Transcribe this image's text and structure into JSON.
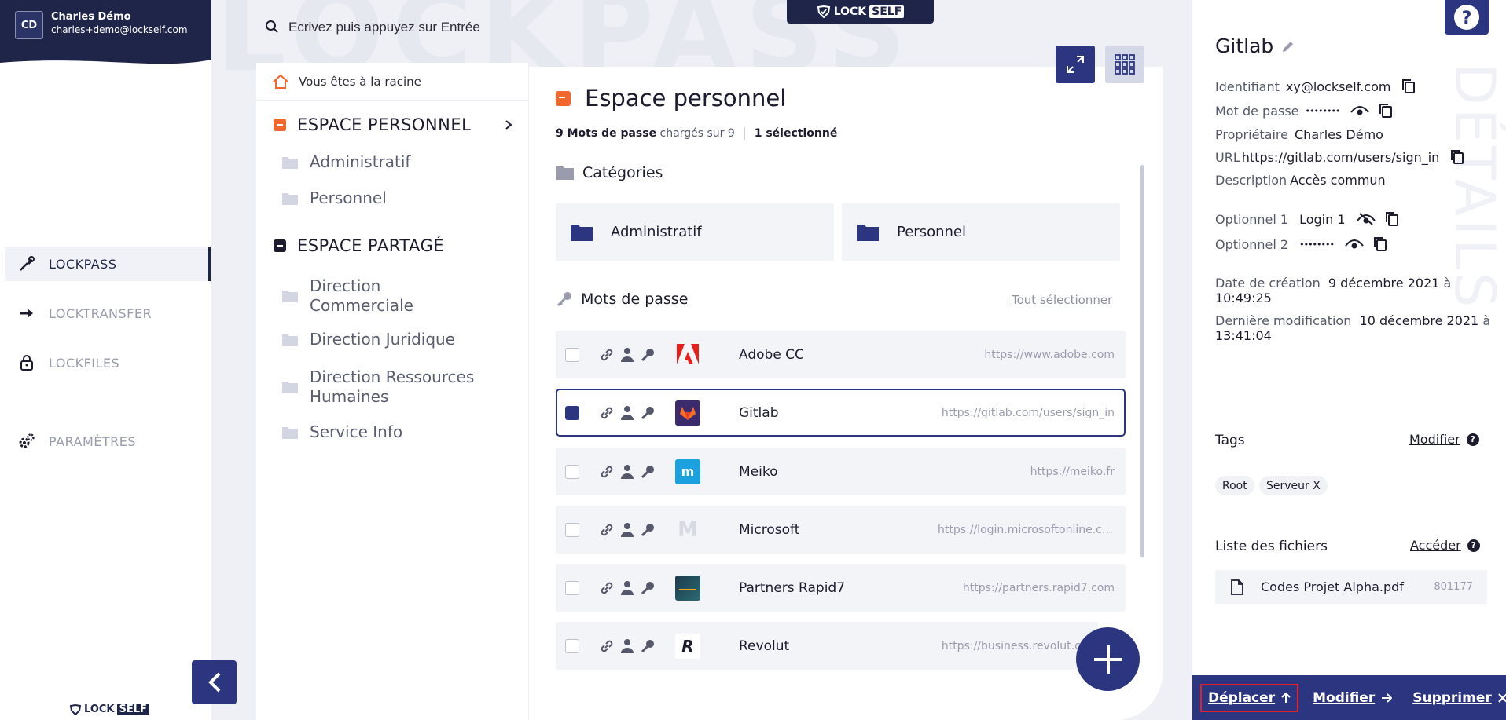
{
  "user": {
    "initials": "CD",
    "name": "Charles Démo",
    "email": "charles+demo@lockself.com"
  },
  "nav": {
    "items": [
      {
        "label": "LOCKPASS",
        "icon": "key-pen-icon",
        "active": true
      },
      {
        "label": "LOCKTRANSFER",
        "icon": "arrow-right-icon",
        "active": false
      },
      {
        "label": "LOCKFILES",
        "icon": "padlock-icon",
        "active": false
      },
      {
        "label": "PARAMÈTRES",
        "icon": "gears-icon",
        "active": false
      }
    ]
  },
  "brand": {
    "lock": "LOCK",
    "self": "SELF"
  },
  "watermark": "LOCKPASS",
  "search": {
    "placeholder": "Ecrivez puis appuyez sur Entrée",
    "value": ""
  },
  "tree": {
    "breadcrumb": "Vous êtes à la racine",
    "personal": {
      "label": "ESPACE PERSONNEL",
      "color": "#f0682d",
      "folders": [
        "Administratif",
        "Personnel"
      ]
    },
    "shared": {
      "label": "ESPACE PARTAGÉ",
      "color": "#1c1c2e",
      "folders": [
        "Direction Commerciale",
        "Direction Juridique",
        "Direction Ressources Humaines",
        "Service Info"
      ]
    }
  },
  "main": {
    "title": "Espace personnel",
    "count_bold": "9 Mots de passe",
    "count_rest": "chargés sur 9",
    "selected": "1 sélectionné",
    "categories_label": "Catégories",
    "categories": [
      "Administratif",
      "Personnel"
    ],
    "passwords_label": "Mots de passe",
    "select_all": "Tout sélectionner",
    "passwords": [
      {
        "name": "Adobe CC",
        "url": "https://www.adobe.com",
        "logo": "adobe-logo",
        "checked": false
      },
      {
        "name": "Gitlab",
        "url": "https://gitlab.com/users/sign_in",
        "logo": "gitlab-logo",
        "checked": true
      },
      {
        "name": "Meiko",
        "url": "https://meiko.fr",
        "logo": "meiko-logo",
        "checked": false
      },
      {
        "name": "Microsoft",
        "url": "https://login.microsoftonline.com",
        "logo": "microsoft-logo",
        "checked": false
      },
      {
        "name": "Partners Rapid7",
        "url": "https://partners.rapid7.com",
        "logo": "rapid7-logo",
        "checked": false
      },
      {
        "name": "Revolut",
        "url": "https://business.revolut.com",
        "logo": "revolut-logo",
        "checked": false
      }
    ]
  },
  "detail": {
    "watermark": "DÉTAILS",
    "title": "Gitlab",
    "identifier_label": "Identifiant",
    "identifier": "xy@lockself.com",
    "password_label": "Mot de passe",
    "password_mask": "••••••••",
    "owner_label": "Propriétaire",
    "owner": "Charles Démo",
    "url_label": "URL",
    "url": "https://gitlab.com/users/sign_in",
    "description_label": "Description",
    "description": "Accès commun",
    "opt1_label": "Optionnel 1",
    "opt1": "Login 1",
    "opt2_label": "Optionnel 2",
    "opt2": "••••••••",
    "created_label": "Date de création",
    "created_date": "9 décembre 2021",
    "created_at": "à",
    "created_time": "10:49:25",
    "modified_label": "Dernière modification",
    "modified_date": "10 décembre 2021",
    "modified_at": "à",
    "modified_time": "13:41:04",
    "tags_label": "Tags",
    "tags_action": "Modifier",
    "tags": [
      "Root",
      "Serveur X"
    ],
    "files_label": "Liste des fichiers",
    "files_action": "Accéder",
    "files": [
      {
        "name": "Codes Projet Alpha.pdf",
        "size": "801177"
      }
    ]
  },
  "actions": {
    "move": "Déplacer",
    "edit": "Modifier",
    "delete": "Supprimer"
  },
  "colors": {
    "navy": "#1f2548",
    "primary": "#2c3680",
    "orange": "#f0682d",
    "highlight": "#e0202d"
  }
}
